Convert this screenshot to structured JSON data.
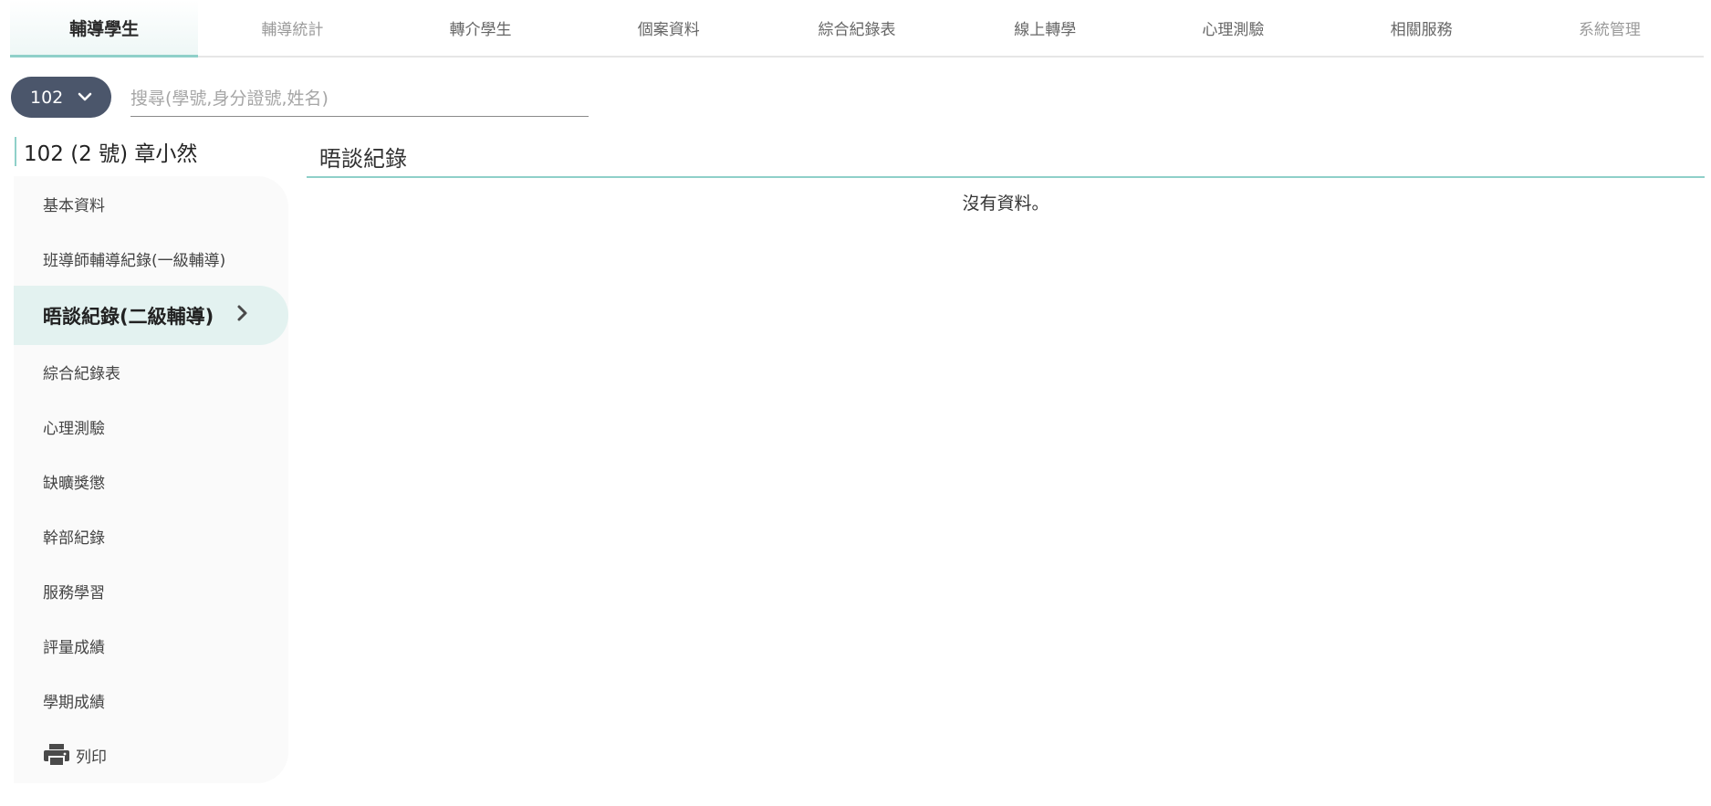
{
  "nav": {
    "tabs": [
      {
        "label": "輔導學生"
      },
      {
        "label": "輔導統計"
      },
      {
        "label": "轉介學生"
      },
      {
        "label": "個案資料"
      },
      {
        "label": "綜合紀錄表"
      },
      {
        "label": "線上轉學"
      },
      {
        "label": "心理測驗"
      },
      {
        "label": "相關服務"
      },
      {
        "label": "系統管理"
      }
    ]
  },
  "class_select": {
    "value": "102"
  },
  "search": {
    "placeholder": "搜尋(學號,身分證號,姓名)"
  },
  "student": {
    "header": "102 (2 號) 章小然"
  },
  "sidebar": {
    "items": [
      {
        "label": "基本資料"
      },
      {
        "label": "班導師輔導紀錄(一級輔導)"
      },
      {
        "label": "晤談紀錄(二級輔導)"
      },
      {
        "label": "綜合紀錄表"
      },
      {
        "label": "心理測驗"
      },
      {
        "label": "缺曠獎懲"
      },
      {
        "label": "幹部紀錄"
      },
      {
        "label": "服務學習"
      },
      {
        "label": "評量成績"
      },
      {
        "label": "學期成績"
      },
      {
        "label": "列印",
        "icon": "printer-icon"
      }
    ]
  },
  "main": {
    "title": "晤談紀錄",
    "empty_text": "沒有資料。"
  },
  "colors": {
    "accent": "#8fd0c9",
    "active_bg": "#e3f2f0",
    "select_bg": "#4b566b"
  }
}
